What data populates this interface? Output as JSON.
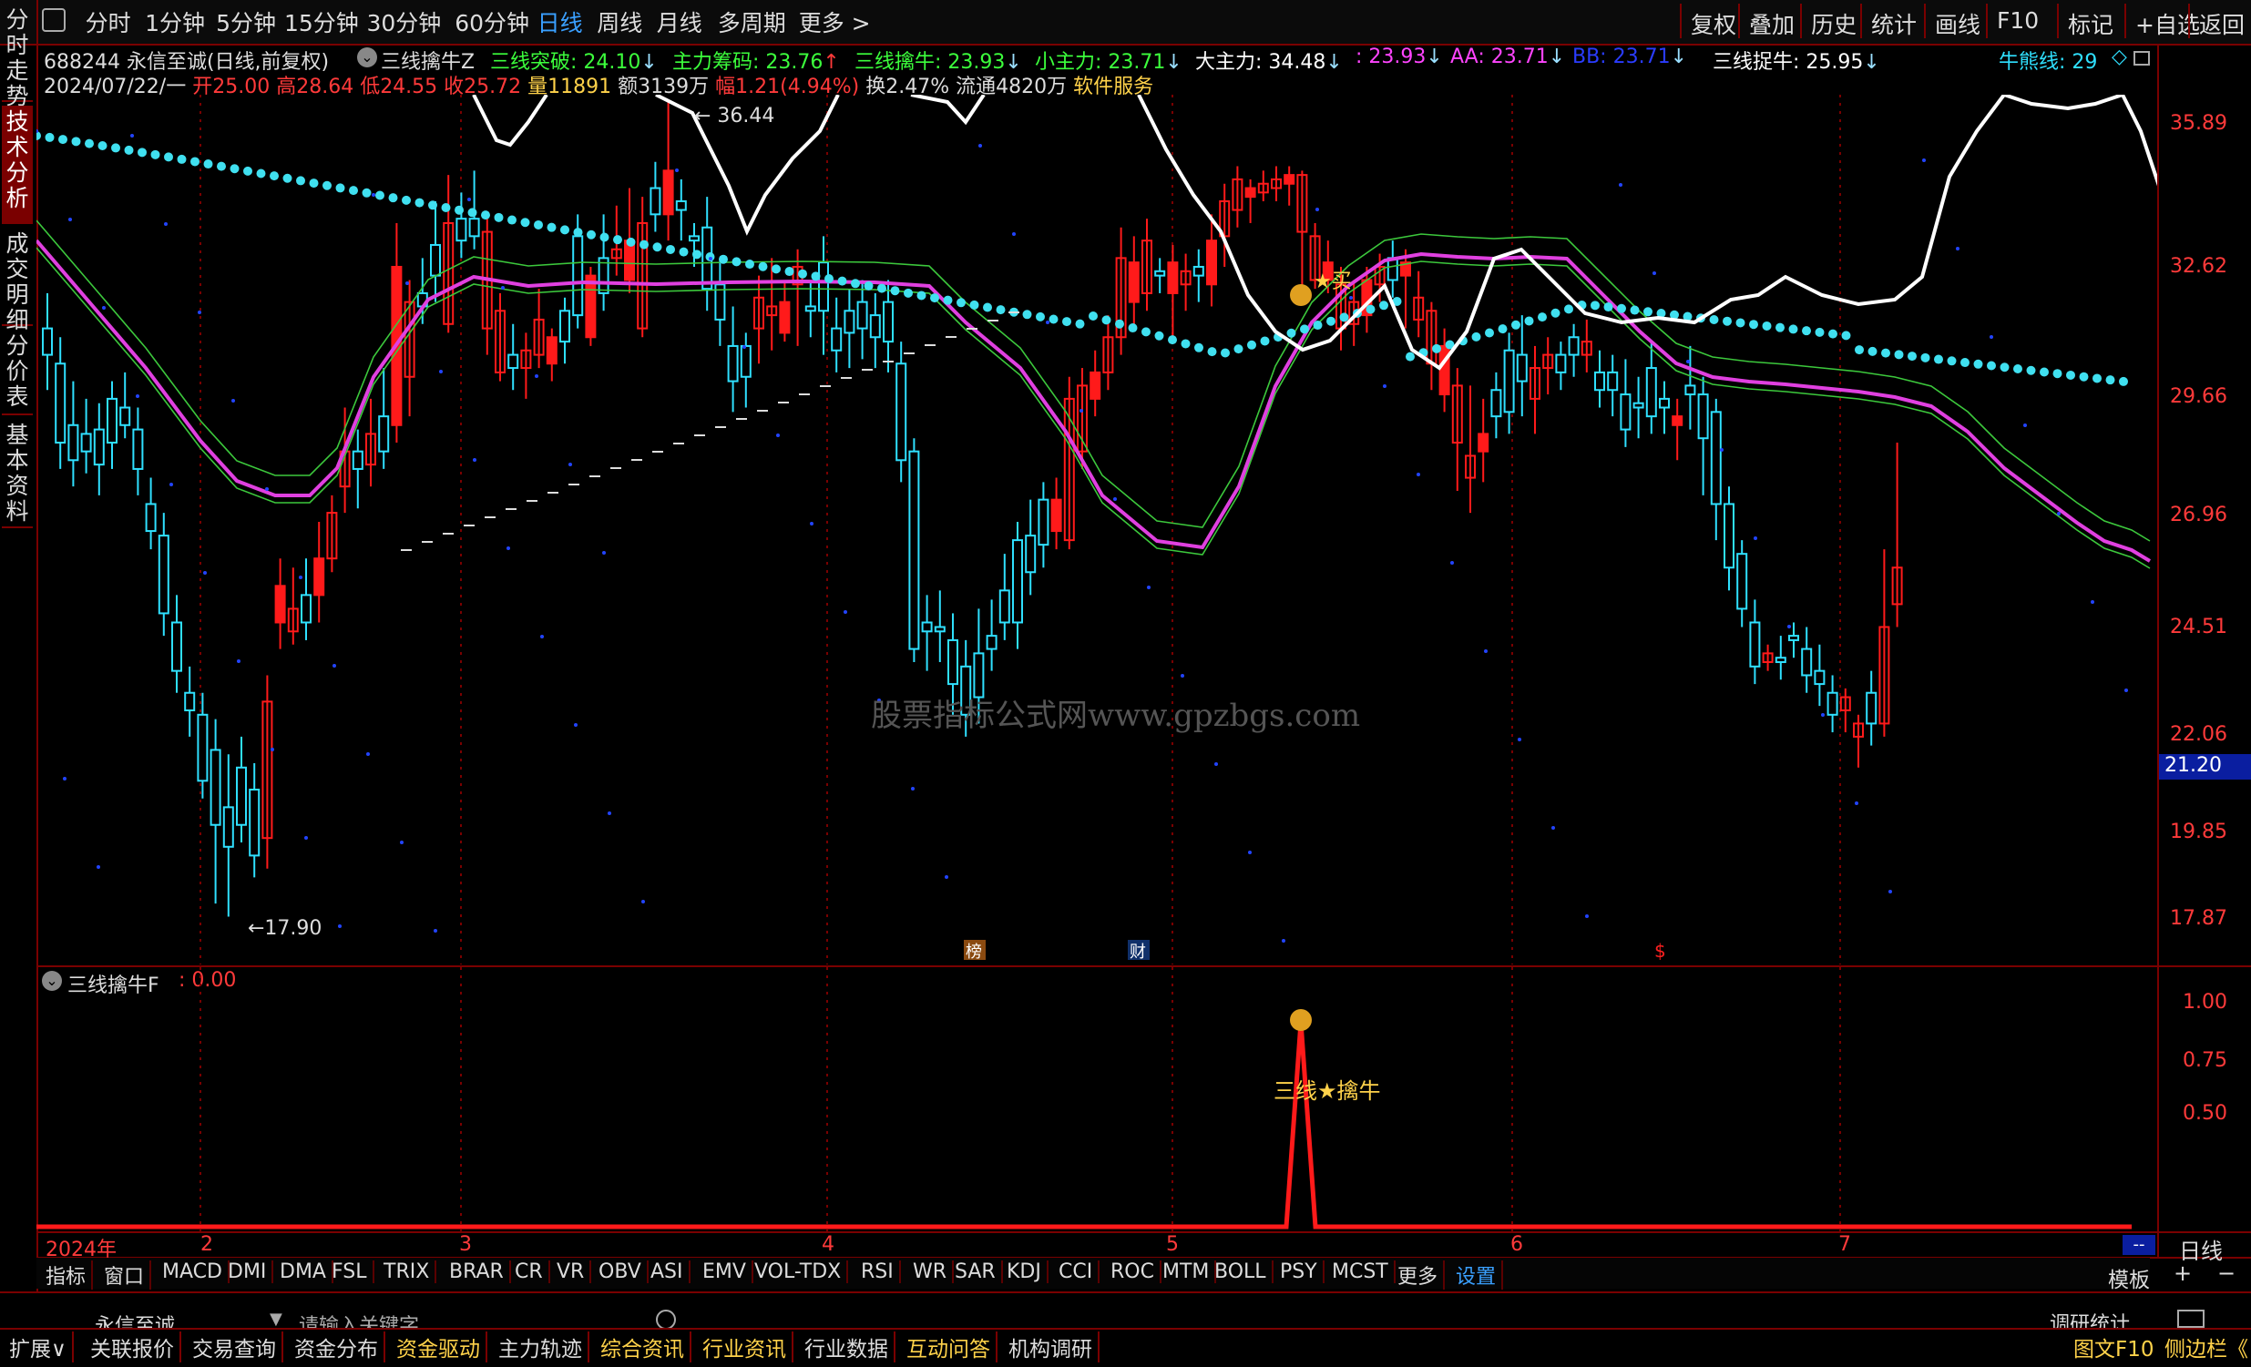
{
  "toolbar": {
    "tabs": [
      "分时",
      "1分钟",
      "5分钟",
      "15分钟",
      "30分钟",
      "60分钟",
      "日线",
      "周线",
      "月线",
      "多周期",
      "更多 >"
    ],
    "active_tab": "日线",
    "right_buttons": [
      "复权",
      "叠加",
      "历史",
      "统计",
      "画线",
      "F10",
      "标记",
      "+自选",
      "返回"
    ]
  },
  "side_tabs": [
    "分时走势",
    "技术分析",
    "成交明细",
    "分价表",
    "基本资料"
  ],
  "stock": {
    "title": "688244 永信至诚(日线,前复权)",
    "indicator_name": "三线擒牛Z",
    "legend": [
      {
        "label": "三线突破: 24.10",
        "arrow": "↓",
        "color": "#3cff3c"
      },
      {
        "label": "主力筹码: 23.76",
        "arrow": "↑",
        "color": "#3cff3c"
      },
      {
        "label": "三线擒牛: 23.93",
        "arrow": "↓",
        "color": "#3cff3c"
      },
      {
        "label": "小主力: 23.71",
        "arrow": "↓",
        "color": "#3cff3c"
      },
      {
        "label": "大主力: 34.48",
        "arrow": "↓",
        "color": "#ffffff"
      },
      {
        "label": ": 23.93",
        "arrow": "↓",
        "color": "#ff44ff"
      },
      {
        "label": "AA: 23.71",
        "arrow": "↓",
        "color": "#ff44ff"
      },
      {
        "label": "BB: 23.71",
        "arrow": "↓",
        "color": "#2a3cff"
      },
      {
        "label": "三线捉牛: 25.95",
        "arrow": "↓",
        "color": "#ffffff"
      }
    ],
    "niuxiongxian": "牛熊线: 29",
    "date": "2024/07/22/一",
    "open": "开25.00",
    "high": "高28.64",
    "low": "低24.55",
    "close": "收25.72",
    "volume": "量11891",
    "amount": "额3139万",
    "change": "幅1.21(4.94%)",
    "turnover": "换2.47%",
    "float": "流通4820万",
    "service": "软件服务"
  },
  "main_axis": [
    "35.89",
    "32.62",
    "29.66",
    "26.96",
    "24.51",
    "22.06",
    "19.85",
    "17.87"
  ],
  "price_marker": "21.20",
  "annotations": {
    "high": "36.44",
    "low": "17.90",
    "buy": "买",
    "bang": "榜",
    "cai": "财",
    "dollar": "$"
  },
  "watermark": "股票指标公式网www.gpzbgs.com",
  "sub": {
    "title": "三线擒牛F",
    "value": ": 0.00",
    "axis": [
      "1.00",
      "0.75",
      "0.50"
    ],
    "signal_label": "三线★擒牛"
  },
  "time_axis": {
    "labels": [
      "2024年",
      "2",
      "3",
      "4",
      "5",
      "6",
      "7"
    ],
    "period": "日线",
    "dash": "--"
  },
  "indicators": [
    "指标",
    "窗口",
    "MACD",
    "DMI",
    "DMA",
    "FSL",
    "TRIX",
    "BRAR",
    "CR",
    "VR",
    "OBV",
    "ASI",
    "EMV",
    "VOL-TDX",
    "RSI",
    "WR",
    "SAR",
    "KDJ",
    "CCI",
    "ROC",
    "MTM",
    "BOLL",
    "PSY",
    "MCST",
    "更多",
    "设置"
  ],
  "template_btn": "模板",
  "search": {
    "stock": "永信至诚",
    "placeholder": "请输入关键字",
    "right": "调研统计"
  },
  "footer_tabs": [
    {
      "label": "扩展∨",
      "color": "#ddd"
    },
    {
      "label": "关联报价",
      "color": "#ddd"
    },
    {
      "label": "交易查询",
      "color": "#ddd"
    },
    {
      "label": "资金分布",
      "color": "#ddd"
    },
    {
      "label": "资金驱动",
      "color": "#ffd24a"
    },
    {
      "label": "主力轨迹",
      "color": "#ddd"
    },
    {
      "label": "综合资讯",
      "color": "#ffd24a"
    },
    {
      "label": "行业资讯",
      "color": "#ffd24a"
    },
    {
      "label": "行业数据",
      "color": "#ddd"
    },
    {
      "label": "互动问答",
      "color": "#ffd24a"
    },
    {
      "label": "机构调研",
      "color": "#ddd"
    }
  ],
  "footer_right": [
    "图文F10",
    "侧边栏《"
  ],
  "colors": {
    "up": "#ff1a1a",
    "down": "#2fe0ff",
    "magenta": "#e040e0",
    "green": "#3cc83c",
    "dots": "#40e0f0",
    "white": "#ffffff"
  }
}
